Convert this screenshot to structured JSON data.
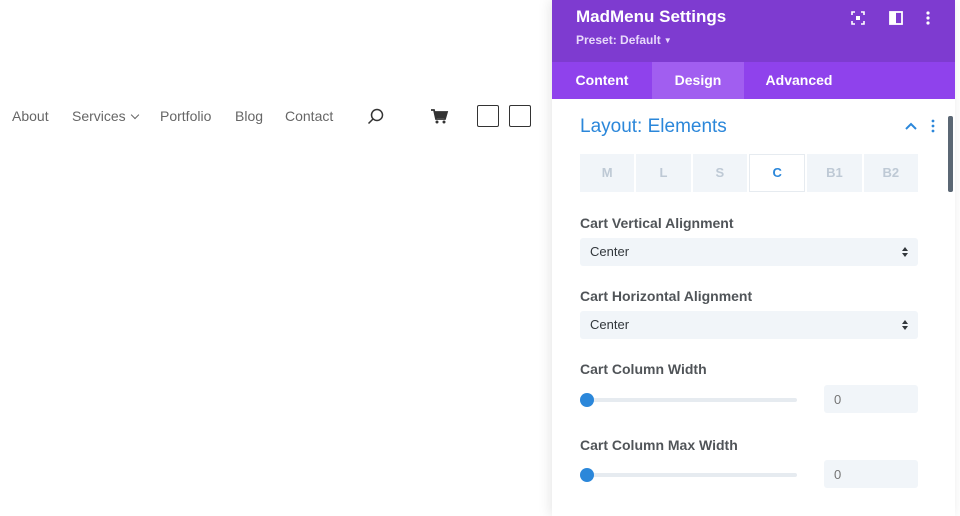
{
  "site_nav": {
    "items": [
      {
        "label": "About"
      },
      {
        "label": "Services",
        "has_dropdown": true
      },
      {
        "label": "Portfolio"
      },
      {
        "label": "Blog"
      },
      {
        "label": "Contact"
      }
    ],
    "icons": [
      "search-icon",
      "cart-icon",
      "square-icon",
      "square-icon"
    ]
  },
  "panel": {
    "title": "MadMenu Settings",
    "preset": "Preset: Default",
    "header_icons": [
      "expand-icon",
      "split-view-icon",
      "more-vertical-icon"
    ],
    "tabs": [
      {
        "label": "Content",
        "active": false
      },
      {
        "label": "Design",
        "active": true
      },
      {
        "label": "Advanced",
        "active": false
      }
    ],
    "section": {
      "title": "Layout: Elements",
      "expanded": true
    },
    "device_tabs": [
      {
        "label": "M",
        "active": false
      },
      {
        "label": "L",
        "active": false
      },
      {
        "label": "S",
        "active": false
      },
      {
        "label": "C",
        "active": true
      },
      {
        "label": "B1",
        "active": false
      },
      {
        "label": "B2",
        "active": false
      }
    ],
    "fields": {
      "cart_vertical_alignment": {
        "label": "Cart Vertical Alignment",
        "value": "Center"
      },
      "cart_horizontal_alignment": {
        "label": "Cart Horizontal Alignment",
        "value": "Center"
      },
      "cart_column_width": {
        "label": "Cart Column Width",
        "placeholder": "0",
        "slider_fraction": 0
      },
      "cart_column_max_width": {
        "label": "Cart Column Max Width",
        "placeholder": "0",
        "slider_fraction": 0
      }
    }
  },
  "colors": {
    "header_purple": "#7e3bd0",
    "tab_purple": "#8f42ec",
    "active_tab": "#a15ef0",
    "accent_blue": "#2b87da",
    "field_bg": "#f1f5f9"
  }
}
